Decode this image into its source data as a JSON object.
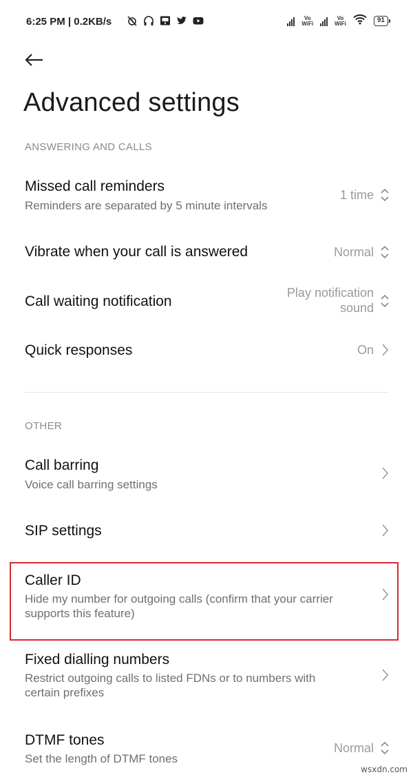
{
  "status_bar": {
    "time": "6:25 PM | 0.2KB/s",
    "wifi_label_1": "Vo",
    "wifi_label_2": "WiFi",
    "battery": "91"
  },
  "header": {
    "title": "Advanced settings"
  },
  "sections": [
    {
      "header": "ANSWERING AND CALLS",
      "items": [
        {
          "title": "Missed call reminders",
          "subtitle": "Reminders are separated by 5 minute intervals",
          "value": "1 time",
          "control": "updown-icon"
        },
        {
          "title": "Vibrate when your call is answered",
          "value": "Normal",
          "control": "updown-icon"
        },
        {
          "title": "Call waiting notification",
          "value_line1": "Play notification",
          "value_line2": "sound",
          "control": "updown-icon"
        },
        {
          "title": "Quick responses",
          "value": "On",
          "control": "chevron-right-icon"
        }
      ]
    },
    {
      "header": "OTHER",
      "items": [
        {
          "title": "Call barring",
          "subtitle": "Voice call barring settings",
          "control": "chevron-right-icon"
        },
        {
          "title": "SIP settings",
          "control": "chevron-right-icon"
        },
        {
          "title": "Caller ID",
          "subtitle_line1": "Hide my number for outgoing calls (confirm that your carrier",
          "subtitle_line2": "supports this feature)",
          "control": "chevron-right-icon",
          "highlighted": true
        },
        {
          "title": "Fixed dialling numbers",
          "subtitle_line1": "Restrict outgoing calls to listed FDNs or to numbers with",
          "subtitle_line2": "certain prefixes",
          "control": "chevron-right-icon"
        },
        {
          "title": "DTMF tones",
          "subtitle": "Set the length of DTMF tones",
          "value": "Normal",
          "control": "updown-icon"
        }
      ]
    }
  ],
  "highlight_color": "#d8262e",
  "watermark": "wsxdn.com"
}
